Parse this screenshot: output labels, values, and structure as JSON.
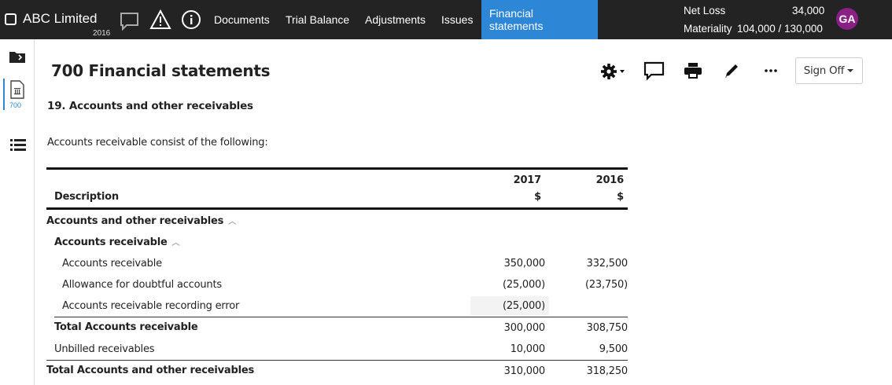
{
  "topbar": {
    "company": "ABC Limited",
    "year": "2016",
    "nav": [
      "Documents",
      "Trial Balance",
      "Adjustments",
      "Issues",
      "Financial statements"
    ],
    "active_nav": "Financial statements",
    "net_loss_label": "Net Loss",
    "net_loss_value": "34,000",
    "materiality_label": "Materiality",
    "materiality_value": "104,000 / 130,000",
    "avatar": "GA",
    "avatar_color": "#8a1f86",
    "accent_color": "#2e86d6"
  },
  "rail": {
    "items": [
      "folder-icon",
      "document-icon",
      "list-icon"
    ],
    "active_number": "700"
  },
  "page": {
    "title": "700 Financial statements",
    "subtitle": "19. Accounts and other receivables",
    "intro": "Accounts receivable consist of the following:",
    "toolbar_icons": [
      "gear-icon",
      "comment-icon",
      "print-icon",
      "pencil-icon",
      "more-icon"
    ],
    "sign_off": "Sign Off"
  },
  "table": {
    "header": {
      "description": "Description",
      "col1_year": "2017",
      "col1_unit": "$",
      "col2_year": "2016",
      "col2_unit": "$"
    },
    "rows": [
      {
        "label": "Accounts and other receivables",
        "v2017": "",
        "v2016": ""
      },
      {
        "label": "Accounts receivable",
        "v2017": "",
        "v2016": ""
      },
      {
        "label": "Accounts receivable",
        "v2017": "350,000",
        "v2016": "332,500"
      },
      {
        "label": "Allowance for doubtful accounts",
        "v2017": "(25,000)",
        "v2016": "(23,750)"
      },
      {
        "label": "Accounts receivable recording error",
        "v2017": "(25,000)",
        "v2016": ""
      },
      {
        "label": "Total Accounts receivable",
        "v2017": "300,000",
        "v2016": "308,750"
      },
      {
        "label": "Unbilled receivables",
        "v2017": "10,000",
        "v2016": "9,500"
      },
      {
        "label": "Total Accounts and other receivables",
        "v2017": "310,000",
        "v2016": "318,250"
      }
    ]
  }
}
